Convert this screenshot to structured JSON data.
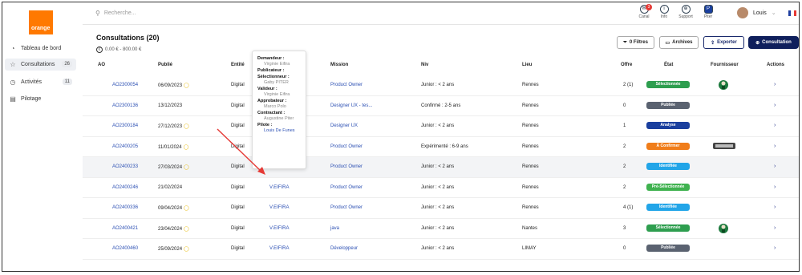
{
  "brand": {
    "name": "orange"
  },
  "sidebar": {
    "items": [
      {
        "label": "Tableau de bord",
        "icon": "dashboard-icon",
        "count": ""
      },
      {
        "label": "Consultations",
        "icon": "star-icon",
        "count": "26"
      },
      {
        "label": "Activités",
        "icon": "activity-icon",
        "count": "11"
      },
      {
        "label": "Pilotage",
        "icon": "document-icon",
        "count": ""
      }
    ]
  },
  "topbar": {
    "search_placeholder": "Recherche...",
    "icons": [
      {
        "label": "Canal",
        "icon": "chat-icon",
        "badge": "3"
      },
      {
        "label": "Info",
        "icon": "info-icon",
        "badge": ""
      },
      {
        "label": "Support",
        "icon": "support-icon",
        "badge": ""
      },
      {
        "label": "Piter",
        "icon": "piter-icon",
        "badge": ""
      }
    ],
    "user": "Louis",
    "language": "FR"
  },
  "page": {
    "title": "Consultations (20)",
    "amount": "0.00 € - 800.00 €",
    "buttons": {
      "filters": "0 Filtres",
      "archives": "Archives",
      "export": "Exporter",
      "new": "Consultation"
    }
  },
  "table": {
    "columns": [
      "AO",
      "Publié",
      "Entité",
      "Mission",
      "Niv",
      "Lieu",
      "Offre",
      "État",
      "Fournisseur",
      "Actions"
    ],
    "rows": [
      {
        "ao": "AO2300054",
        "date": "06/09/2023",
        "bulb": true,
        "entity": "Digital",
        "person": "",
        "mission": "Product Owner",
        "level": "Junior : < 2 ans",
        "place": "Rennes",
        "offer": "2 (1)",
        "status": "Sélectionnée",
        "status_color": "#2e9e4f",
        "supplier": "celtics"
      },
      {
        "ao": "AO2300136",
        "date": "13/12/2023",
        "bulb": false,
        "entity": "Digital",
        "person": "",
        "mission": "Designer UX - tes...",
        "level": "Confirmé : 2-5 ans",
        "place": "Rennes",
        "offer": "0",
        "status": "Publiée",
        "status_color": "#5a6270",
        "supplier": ""
      },
      {
        "ao": "AO2300184",
        "date": "27/12/2023",
        "bulb": true,
        "entity": "Digital",
        "person": "",
        "mission": "Designer UX",
        "level": "Junior : < 2 ans",
        "place": "Rennes",
        "offer": "1",
        "status": "Analyse",
        "status_color": "#1a3f9e",
        "supplier": ""
      },
      {
        "ao": "AO2400205",
        "date": "11/01/2024",
        "bulb": true,
        "entity": "Digital",
        "person": "",
        "mission": "Product Owner",
        "level": "Expérimenté : 6-9 ans",
        "place": "Rennes",
        "offer": "2",
        "status": "À Confirmer",
        "status_color": "#f07d1a",
        "supplier": "spurs"
      },
      {
        "ao": "AO2400233",
        "date": "27/03/2024",
        "bulb": true,
        "entity": "Digital",
        "person": "V.EIFIRA",
        "mission": "Product Owner",
        "level": "Junior : < 2 ans",
        "place": "Rennes",
        "offer": "2",
        "status": "Identifiée",
        "status_color": "#22a5e8",
        "supplier": ""
      },
      {
        "ao": "AO2400246",
        "date": "21/02/2024",
        "bulb": false,
        "entity": "Digital",
        "person": "V.EIFIRA",
        "mission": "Product Owner",
        "level": "Junior : < 2 ans",
        "place": "Rennes",
        "offer": "2",
        "status": "Pré-Sélectionnée",
        "status_color": "#3fb24f",
        "supplier": ""
      },
      {
        "ao": "AO2400336",
        "date": "09/04/2024",
        "bulb": true,
        "entity": "Digital",
        "person": "V.EIFIRA",
        "mission": "Product Owner",
        "level": "Junior : < 2 ans",
        "place": "Rennes",
        "offer": "4 (1)",
        "status": "Identifiée",
        "status_color": "#22a5e8",
        "supplier": ""
      },
      {
        "ao": "AO2400421",
        "date": "23/04/2024",
        "bulb": true,
        "entity": "Digital",
        "person": "V.EIFIRA",
        "mission": "java",
        "level": "Junior : < 2 ans",
        "place": "Nantes",
        "offer": "3",
        "status": "Sélectionnée",
        "status_color": "#2e9e4f",
        "supplier": "celtics"
      },
      {
        "ao": "AO2400460",
        "date": "25/09/2024",
        "bulb": true,
        "entity": "Digital",
        "person": "V.EIFIRA",
        "mission": "Développeur",
        "level": "Junior : < 2 ans",
        "place": "LIMAY",
        "offer": "0",
        "status": "Publiée",
        "status_color": "#5a6270",
        "supplier": ""
      }
    ]
  },
  "tooltip": [
    {
      "label": "Demandeur :",
      "value": "Virginie Eifira",
      "blue": false
    },
    {
      "label": "Publicateur :",
      "value": "",
      "blue": false
    },
    {
      "label": "Sélectionneur :",
      "value": "Gaby PITER",
      "blue": false
    },
    {
      "label": "Valideur :",
      "value": "Virginie Eifira",
      "blue": false
    },
    {
      "label": "Approbateur :",
      "value": "Marco Polo",
      "blue": false
    },
    {
      "label": "Contractant :",
      "value": "Augustine Piter",
      "blue": false
    },
    {
      "label": "Pilote :",
      "value": "Louis De Funes",
      "blue": true
    }
  ],
  "annotation": {
    "color": "#e53935"
  }
}
